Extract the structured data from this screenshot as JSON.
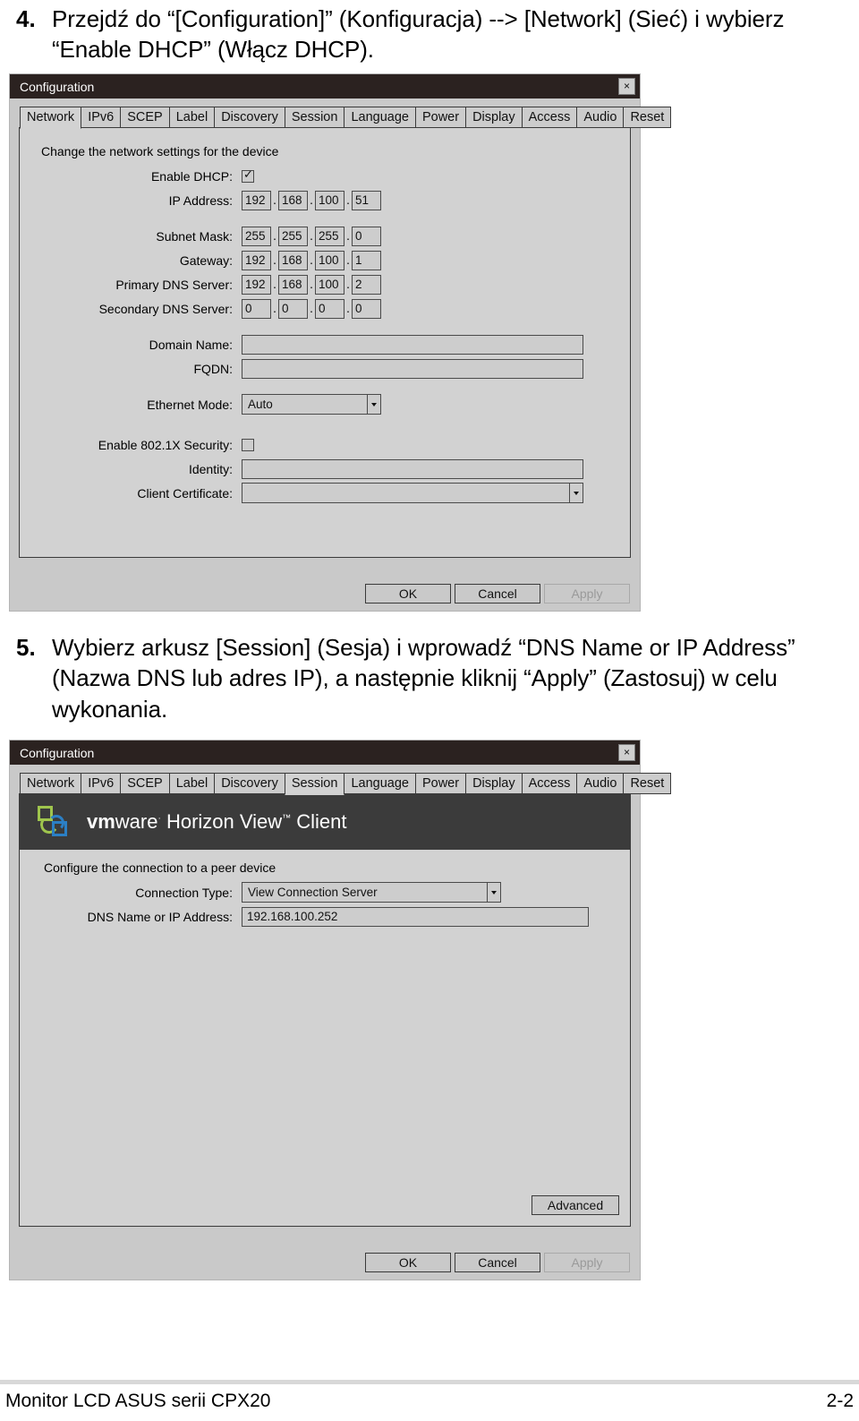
{
  "steps": [
    {
      "number": "4.",
      "text": "Przejdź do “[Configuration]” (Konfiguracja) --> [Network] (Sieć) i wybierz “Enable DHCP” (Włącz DHCP)."
    },
    {
      "number": "5.",
      "text": "Wybierz arkusz [Session] (Sesja) i wprowadź “DNS Name or IP Address” (Nazwa DNS lub adres IP), a następnie kliknij “Apply” (Zastosuj) w celu wykonania."
    }
  ],
  "dialog_network": {
    "title": "Configuration",
    "close_label": "×",
    "tabs": [
      {
        "label": "Network",
        "active": true
      },
      {
        "label": "IPv6",
        "active": false
      },
      {
        "label": "SCEP",
        "active": false
      },
      {
        "label": "Label",
        "active": false
      },
      {
        "label": "Discovery",
        "active": false
      },
      {
        "label": "Session",
        "active": false
      },
      {
        "label": "Language",
        "active": false
      },
      {
        "label": "Power",
        "active": false
      },
      {
        "label": "Display",
        "active": false
      },
      {
        "label": "Access",
        "active": false
      },
      {
        "label": "Audio",
        "active": false
      },
      {
        "label": "Reset",
        "active": false
      }
    ],
    "panel_heading": "Change the network settings for the device",
    "fields": {
      "enable_dhcp_label": "Enable DHCP:",
      "enable_dhcp_checked": true,
      "ip_address_label": "IP Address:",
      "ip_address": [
        "192",
        "168",
        "100",
        "51"
      ],
      "subnet_mask_label": "Subnet Mask:",
      "subnet_mask": [
        "255",
        "255",
        "255",
        "0"
      ],
      "gateway_label": "Gateway:",
      "gateway": [
        "192",
        "168",
        "100",
        "1"
      ],
      "primary_dns_label": "Primary DNS Server:",
      "primary_dns": [
        "192",
        "168",
        "100",
        "2"
      ],
      "secondary_dns_label": "Secondary DNS Server:",
      "secondary_dns": [
        "0",
        "0",
        "0",
        "0"
      ],
      "domain_name_label": "Domain Name:",
      "domain_name": "",
      "fqdn_label": "FQDN:",
      "fqdn": "",
      "ethernet_mode_label": "Ethernet Mode:",
      "ethernet_mode": "Auto",
      "enable_8021x_label": "Enable 802.1X Security:",
      "enable_8021x_checked": false,
      "identity_label": "Identity:",
      "identity": "",
      "client_certificate_label": "Client Certificate:",
      "client_certificate": ""
    },
    "buttons": {
      "ok": "OK",
      "cancel": "Cancel",
      "apply": "Apply",
      "apply_disabled": true
    }
  },
  "dialog_session": {
    "title": "Configuration",
    "close_label": "×",
    "tabs": [
      {
        "label": "Network",
        "active": false
      },
      {
        "label": "IPv6",
        "active": false
      },
      {
        "label": "SCEP",
        "active": false
      },
      {
        "label": "Label",
        "active": false
      },
      {
        "label": "Discovery",
        "active": false
      },
      {
        "label": "Session",
        "active": true
      },
      {
        "label": "Language",
        "active": false
      },
      {
        "label": "Power",
        "active": false
      },
      {
        "label": "Display",
        "active": false
      },
      {
        "label": "Access",
        "active": false
      },
      {
        "label": "Audio",
        "active": false
      },
      {
        "label": "Reset",
        "active": false
      }
    ],
    "brand": {
      "vm": "vm",
      "ware": "ware",
      "registered": "·",
      "product": " Horizon View",
      "trademark": "™",
      "client": " Client"
    },
    "panel_heading": "Configure the connection to a peer device",
    "fields": {
      "connection_type_label": "Connection Type:",
      "connection_type": "View Connection Server",
      "dns_name_label": "DNS Name or IP Address:",
      "dns_name": "192.168.100.252"
    },
    "buttons": {
      "advanced": "Advanced",
      "ok": "OK",
      "cancel": "Cancel",
      "apply": "Apply",
      "apply_disabled": true
    }
  },
  "footer": {
    "left": "Monitor LCD ASUS serii CPX20",
    "right": "2-2"
  }
}
